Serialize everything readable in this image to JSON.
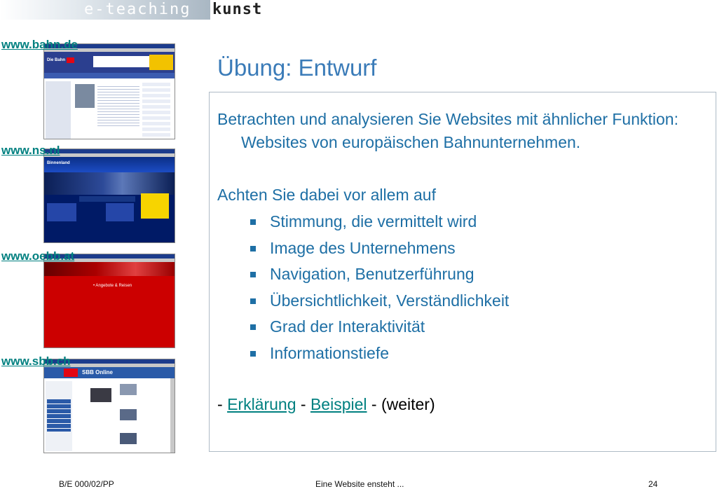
{
  "header": {
    "logo_left": "e-teaching",
    "logo_right": "kunst"
  },
  "sidebar": {
    "links": [
      {
        "label": "www.bahn.de"
      },
      {
        "label": "www.ns.nl"
      },
      {
        "label": "www.oebb.at"
      },
      {
        "label": "www.sbb.ch"
      }
    ],
    "thumbs": {
      "bahn_brand": "Die Bahn",
      "ns_brand": "Binnenland",
      "oebb_menu": [
        "• Angebote & Reisen"
      ],
      "sbb_brand": "SBB Online"
    }
  },
  "slide": {
    "title": "Übung: Entwurf",
    "paragraph1": "Betrachten und analysieren Sie Websites mit ähnlicher Funktion: Websites von europäischen Bahnunternehmen.",
    "paragraph2": "Achten Sie dabei vor allem auf",
    "bullets": [
      "Stimmung, die vermittelt wird",
      "Image des Unternehmens",
      "Navigation, Benutzerführung",
      "Übersichtlichkeit, Verständlichkeit",
      "Grad der Interaktivität",
      "Informationstiefe"
    ],
    "nav": {
      "prefix": "- ",
      "link1": "Erklärung",
      "sep": " - ",
      "link2": "Beispiel",
      "suffix": " - (weiter)"
    }
  },
  "footer": {
    "left": "B/E 000/02/PP",
    "center": "Eine Website ensteht ...",
    "page": "24"
  },
  "colors": {
    "title": "#3a7bb8",
    "body_text": "#1e6fa5",
    "link": "#008080"
  }
}
